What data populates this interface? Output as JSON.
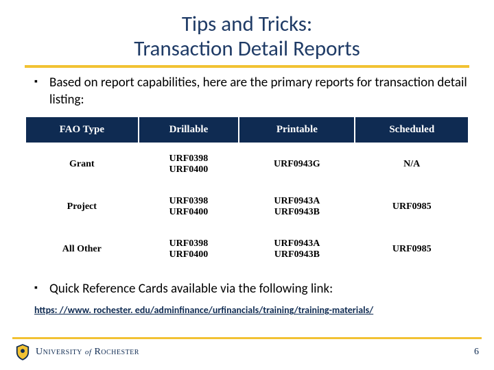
{
  "title": "Tips and Tricks:\nTransaction Detail Reports",
  "bullet1": "Based on report capabilities, here are the primary reports for transaction detail listing:",
  "bullet2": "Quick Reference Cards available via the following link:",
  "link": "https: //www. rochester. edu/adminfinance/urfinancials/training/training-materials/",
  "table": {
    "headers": [
      "FAO Type",
      "Drillable",
      "Printable",
      "Scheduled"
    ],
    "rows": [
      {
        "c0": "Grant",
        "c1": "URF0398\nURF0400",
        "c2": "URF0943G",
        "c3": "N/A"
      },
      {
        "c0": "Project",
        "c1": "URF0398\nURF0400",
        "c2": "URF0943A\nURF0943B",
        "c3": "URF0985"
      },
      {
        "c0": "All Other",
        "c1": "URF0398\nURF0400",
        "c2": "URF0943A\nURF0943B",
        "c3": "URF0985"
      }
    ]
  },
  "logo": {
    "univ": "University",
    "of": "of",
    "roch": "Rochester"
  },
  "pagenum": "6"
}
